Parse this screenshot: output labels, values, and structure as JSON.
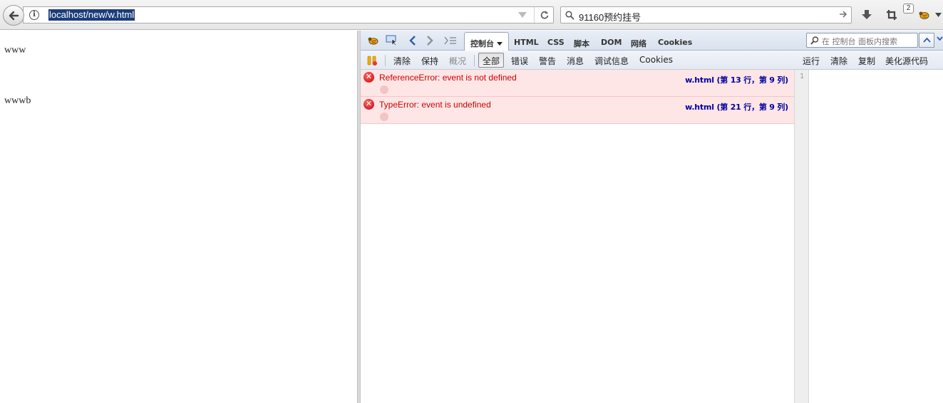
{
  "browser": {
    "url": "localhost/new/w.html",
    "search_value": "91160预约挂号",
    "notification_count": "2"
  },
  "page": {
    "lines": [
      "www",
      "wwwb"
    ]
  },
  "firebug": {
    "tabs": [
      {
        "label": "控制台",
        "active": true
      },
      {
        "label": "HTML"
      },
      {
        "label": "CSS"
      },
      {
        "label": "脚本"
      },
      {
        "label": "DOM"
      },
      {
        "label": "网络"
      },
      {
        "label": "Cookies"
      }
    ],
    "search_placeholder": "在 控制台 面板内搜索",
    "toolbar": {
      "clear": "清除",
      "persist": "保持",
      "profile": "概况",
      "filters": [
        "全部",
        "错误",
        "警告",
        "消息",
        "调试信息",
        "Cookies"
      ],
      "right": [
        "运行",
        "清除",
        "复制",
        "美化源代码"
      ]
    },
    "messages": [
      {
        "text": "ReferenceError: event is not defined",
        "source": "w.html (第 13 行，第 9 列)"
      },
      {
        "text": "TypeError: event is undefined",
        "source": "w.html (第 21 行，第 9 列)"
      }
    ],
    "command_line_number": "1"
  },
  "colors": {
    "error_text": "#cc0000",
    "error_row_bg": "#ffe6e6",
    "source_link": "#0000a0",
    "url_selection": "#1c3d7a"
  }
}
